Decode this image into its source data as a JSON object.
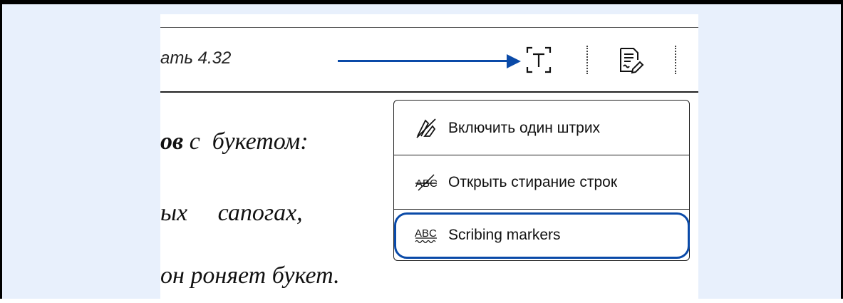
{
  "toolbar": {
    "title": "ать 4.32",
    "text_select_icon": "text-select-icon",
    "notes_icon": "notes-icon"
  },
  "book": {
    "line1_bold": "ов",
    "line1_rest": " с  букетом:",
    "line2": "ых     сапогах,",
    "line3": "он роняет букет."
  },
  "menu": {
    "items": [
      {
        "label": "Включить один штрих",
        "icon": "single-stroke-icon"
      },
      {
        "label": "Открыть стирание строк",
        "icon": "strike-erase-icon"
      },
      {
        "label": "Scribing markers",
        "icon": "abc-wavy-icon"
      }
    ]
  },
  "colors": {
    "accent": "#0a4aa8",
    "background": "#e8f0fc",
    "frame": "#000000"
  }
}
